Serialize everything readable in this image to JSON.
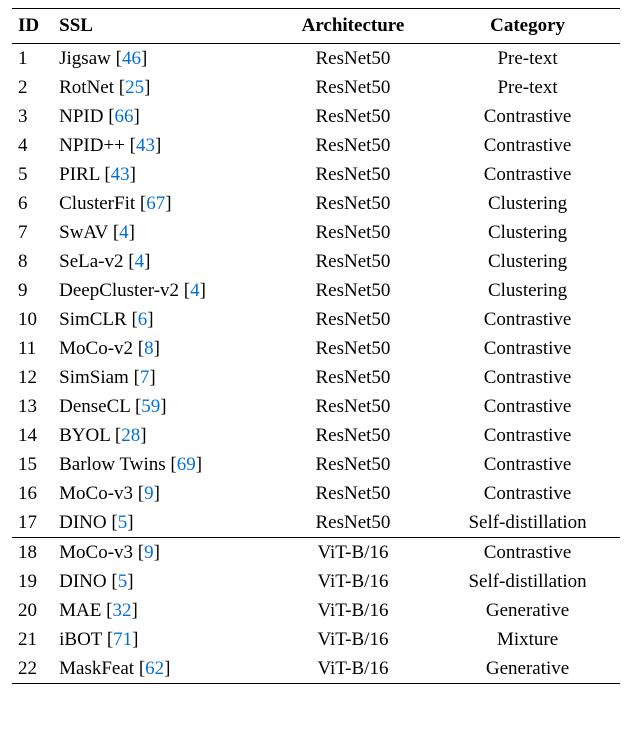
{
  "headers": {
    "id": "ID",
    "ssl": "SSL",
    "arch": "Architecture",
    "cat": "Category"
  },
  "rows": [
    {
      "id": "1",
      "name": "Jigsaw",
      "cite": "46",
      "arch": "ResNet50",
      "cat": "Pre-text",
      "break": false
    },
    {
      "id": "2",
      "name": "RotNet",
      "cite": "25",
      "arch": "ResNet50",
      "cat": "Pre-text",
      "break": false
    },
    {
      "id": "3",
      "name": "NPID",
      "cite": "66",
      "arch": "ResNet50",
      "cat": "Contrastive",
      "break": false
    },
    {
      "id": "4",
      "name": "NPID++",
      "cite": "43",
      "arch": "ResNet50",
      "cat": "Contrastive",
      "break": false
    },
    {
      "id": "5",
      "name": "PIRL",
      "cite": "43",
      "arch": "ResNet50",
      "cat": "Contrastive",
      "break": false
    },
    {
      "id": "6",
      "name": "ClusterFit",
      "cite": "67",
      "arch": "ResNet50",
      "cat": "Clustering",
      "break": false
    },
    {
      "id": "7",
      "name": "SwAV",
      "cite": "4",
      "arch": "ResNet50",
      "cat": "Clustering",
      "break": false
    },
    {
      "id": "8",
      "name": "SeLa-v2",
      "cite": "4",
      "arch": "ResNet50",
      "cat": "Clustering",
      "break": false
    },
    {
      "id": "9",
      "name": "DeepCluster-v2",
      "cite": "4",
      "arch": "ResNet50",
      "cat": "Clustering",
      "break": false
    },
    {
      "id": "10",
      "name": "SimCLR",
      "cite": "6",
      "arch": "ResNet50",
      "cat": "Contrastive",
      "break": false
    },
    {
      "id": "11",
      "name": "MoCo-v2",
      "cite": "8",
      "arch": "ResNet50",
      "cat": "Contrastive",
      "break": false
    },
    {
      "id": "12",
      "name": "SimSiam",
      "cite": "7",
      "arch": "ResNet50",
      "cat": "Contrastive",
      "break": false
    },
    {
      "id": "13",
      "name": "DenseCL",
      "cite": "59",
      "arch": "ResNet50",
      "cat": "Contrastive",
      "break": false
    },
    {
      "id": "14",
      "name": "BYOL",
      "cite": "28",
      "arch": "ResNet50",
      "cat": "Contrastive",
      "break": false
    },
    {
      "id": "15",
      "name": "Barlow Twins",
      "cite": "69",
      "arch": "ResNet50",
      "cat": "Contrastive",
      "break": false
    },
    {
      "id": "16",
      "name": "MoCo-v3",
      "cite": "9",
      "arch": "ResNet50",
      "cat": "Contrastive",
      "break": false
    },
    {
      "id": "17",
      "name": "DINO",
      "cite": "5",
      "arch": "ResNet50",
      "cat": "Self-distillation",
      "break": false
    },
    {
      "id": "18",
      "name": "MoCo-v3",
      "cite": "9",
      "arch": "ViT-B/16",
      "cat": "Contrastive",
      "break": true
    },
    {
      "id": "19",
      "name": "DINO",
      "cite": "5",
      "arch": "ViT-B/16",
      "cat": "Self-distillation",
      "break": false
    },
    {
      "id": "20",
      "name": "MAE",
      "cite": "32",
      "arch": "ViT-B/16",
      "cat": "Generative",
      "break": false
    },
    {
      "id": "21",
      "name": "iBOT",
      "cite": "71",
      "arch": "ViT-B/16",
      "cat": "Mixture",
      "break": false
    },
    {
      "id": "22",
      "name": "MaskFeat",
      "cite": "62",
      "arch": "ViT-B/16",
      "cat": "Generative",
      "break": false
    }
  ]
}
